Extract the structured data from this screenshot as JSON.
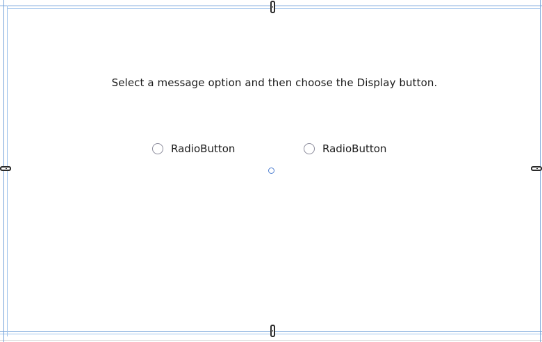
{
  "instruction": "Select a message option and then choose the Display button.",
  "radios": [
    {
      "label": "RadioButton",
      "checked": false
    },
    {
      "label": "RadioButton",
      "checked": false
    }
  ],
  "colors": {
    "guide": "#9fc3ec",
    "guide_dark": "#6f9fd8",
    "handle": "#2b2b2b",
    "center_point": "#4f7fd0",
    "text": "#1a1a1a"
  }
}
